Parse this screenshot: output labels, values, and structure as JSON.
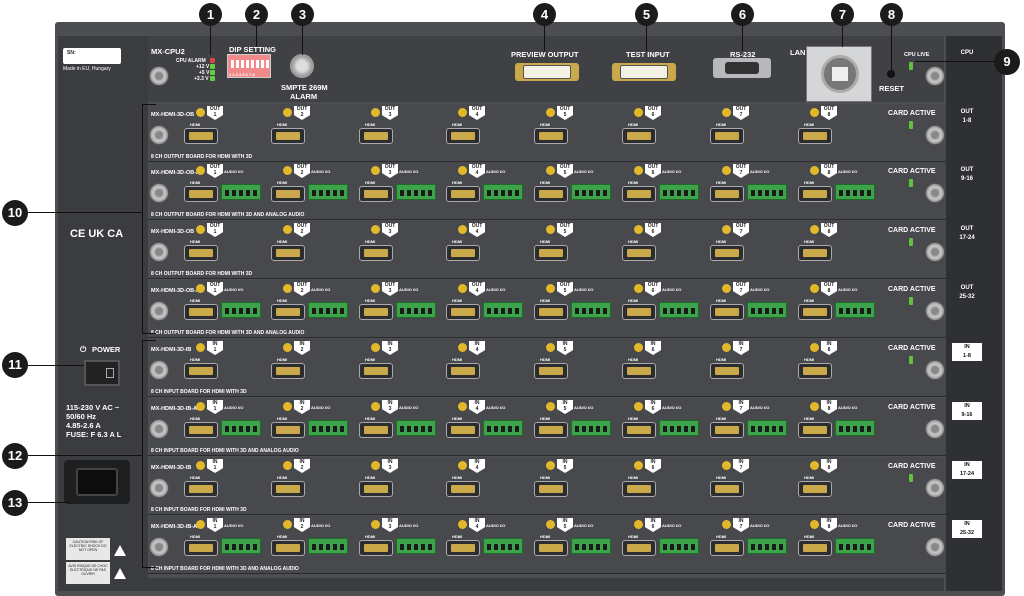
{
  "cpu": {
    "serial_label": "SN:",
    "made_in": "Made in EU, Hungary",
    "model": "MX-CPU2",
    "led_labels": [
      "CPU ALARM",
      "+12 V",
      "+5 V",
      "+3.3 V"
    ],
    "dip_label": "DIP SETTING",
    "dip_numbers": "1 2 3 4 5 6 7 8",
    "smpte_label": "SMPTE 269M",
    "alarm_label": "ALARM",
    "preview_label": "PREVIEW OUTPUT",
    "test_label": "TEST INPUT",
    "rs232_label": "RS-232",
    "lan_label": "LAN",
    "reset_label": "RESET",
    "cpu_live_label": "CPU LIVE",
    "right_label": "CPU"
  },
  "left_panel": {
    "power_label": "POWER",
    "power_symbol": "⏻",
    "certs": "CE UK CA",
    "voltage": "115-230 V AC ~",
    "frequency": "50/60 Hz",
    "current": "4.85-2.6 A",
    "fuse": "FUSE: F 6.3 A L",
    "warn1": "CAUTION RISK OF ELECTRIC SHOCK DO NOT OPEN",
    "warn2": "AVIS RISQUE DE CHOC ELECTRIQUE NE PAS OUVRIR"
  },
  "common": {
    "card_active": "CARD ACTIVE",
    "hdmi": "HDMI",
    "audio_io": "AUDIO I/O",
    "out_tag": "OUT",
    "in_tag": "IN",
    "audio_pins": "L - ⏚ - R"
  },
  "boards": [
    {
      "name": "MX-HDMI-3D-OB",
      "desc": "8 CH OUTPUT BOARD FOR HDMI WITH 3D",
      "tag": "OUT",
      "audio": false,
      "range_a": "OUT",
      "range_b": "1-8",
      "card_active": true
    },
    {
      "name": "MX-HDMI-3D-OB-A",
      "desc": "8 CH OUTPUT BOARD FOR HDMI WITH 3D AND ANALOG AUDIO",
      "tag": "OUT",
      "audio": true,
      "range_a": "OUT",
      "range_b": "9-16",
      "card_active": true
    },
    {
      "name": "MX-HDMI-3D-OB",
      "desc": "8 CH OUTPUT BOARD FOR HDMI WITH 3D",
      "tag": "OUT",
      "audio": false,
      "range_a": "OUT",
      "range_b": "17-24",
      "card_active": true
    },
    {
      "name": "MX-HDMI-3D-OB-A",
      "desc": "8 CH OUTPUT BOARD FOR HDMI WITH 3D AND ANALOG AUDIO",
      "tag": "OUT",
      "audio": true,
      "range_a": "OUT",
      "range_b": "25-32",
      "card_active": true
    },
    {
      "name": "MX-HDMI-3D-IB",
      "desc": "8 CH INPUT BOARD FOR HDMI WITH 3D",
      "tag": "IN",
      "audio": false,
      "range_a": "IN",
      "range_b": "1-8",
      "card_active": true
    },
    {
      "name": "MX-HDMI-3D-IB-A",
      "desc": "8 CH INPUT BOARD FOR HDMI WITH 3D AND ANALOG AUDIO",
      "tag": "IN",
      "audio": true,
      "range_a": "IN",
      "range_b": "9-16",
      "card_active": false
    },
    {
      "name": "MX-HDMI-3D-IB",
      "desc": "8 CH INPUT BOARD FOR HDMI WITH 3D",
      "tag": "IN",
      "audio": false,
      "range_a": "IN",
      "range_b": "17-24",
      "card_active": true
    },
    {
      "name": "MX-HDMI-3D-IB-A",
      "desc": "8 CH INPUT BOARD FOR HDMI WITH 3D AND ANALOG AUDIO",
      "tag": "IN",
      "audio": true,
      "range_a": "IN",
      "range_b": "25-32",
      "card_active": false
    }
  ],
  "callouts": [
    "1",
    "2",
    "3",
    "4",
    "5",
    "6",
    "7",
    "8",
    "9",
    "10",
    "11",
    "12",
    "13"
  ],
  "colors": {
    "chassis": "#4c4e51",
    "hdmi_gold": "#c9a949",
    "led_green": "#64c140",
    "terminal_green": "#3ca34a",
    "callout": "#1b1b1b"
  }
}
